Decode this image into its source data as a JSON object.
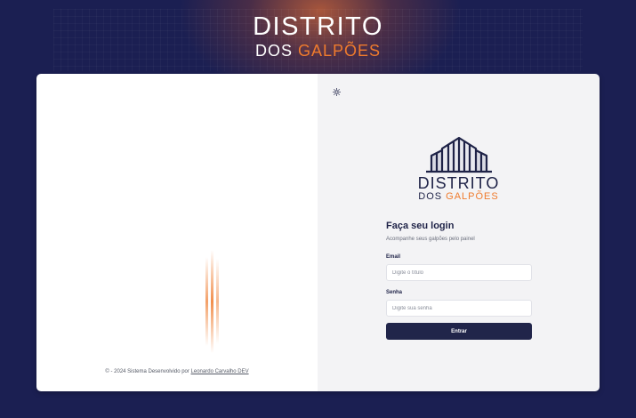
{
  "header_logo": {
    "line1": "DISTRITO",
    "line2_a": "DOS ",
    "line2_b": "GALPÕES"
  },
  "left_panel": {
    "footer_prefix": "© - 2024 Sistema Desenvolvido por ",
    "footer_link": "Leonardo Carvalho DEV"
  },
  "right_panel": {
    "theme_icon": "sun-icon",
    "brand": {
      "line1": "DISTRITO",
      "line2_a": "DOS ",
      "line2_b": "GALPÕES"
    },
    "form": {
      "title": "Faça seu login",
      "subtitle": "Acompanhe seus galpões pelo painel",
      "email_label": "Email",
      "email_placeholder": "Digite o título",
      "email_value": "",
      "password_label": "Senha",
      "password_placeholder": "Digite sua senha",
      "password_value": "",
      "submit_label": "Entrar"
    }
  },
  "colors": {
    "background": "#1b1f52",
    "accent": "#ef7b2d",
    "navy": "#1e2247",
    "button": "#21254a"
  }
}
